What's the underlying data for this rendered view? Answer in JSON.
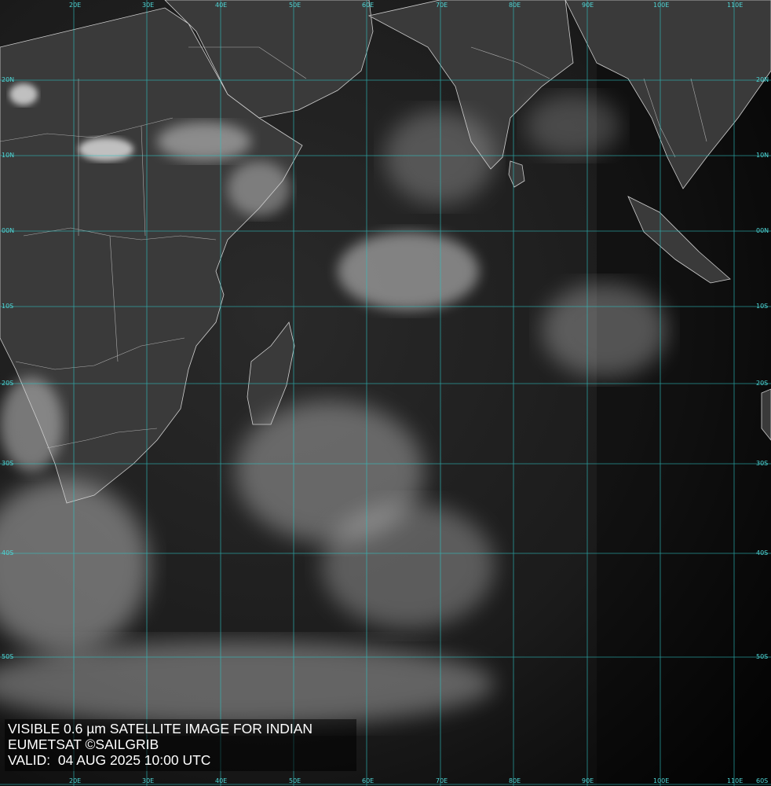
{
  "caption": {
    "line1": "VISIBLE 0.6 µm SATELLITE IMAGE FOR INDIAN",
    "line2": "EUMETSAT ©SAILGRIB",
    "line3": "VALID:  04 AUG 2025 10:00 UTC"
  },
  "grid": {
    "longitude_labels": [
      "20E",
      "30E",
      "40E",
      "50E",
      "60E",
      "70E",
      "80E",
      "90E",
      "100E",
      "110E"
    ],
    "latitude_labels": [
      "20N",
      "10N",
      "00N",
      "10S",
      "20S",
      "30S",
      "40S",
      "50S",
      "60S"
    ]
  },
  "colors": {
    "gridline": "#2fc4c4",
    "coastline": "#d8d8d8",
    "background": "#101010"
  }
}
